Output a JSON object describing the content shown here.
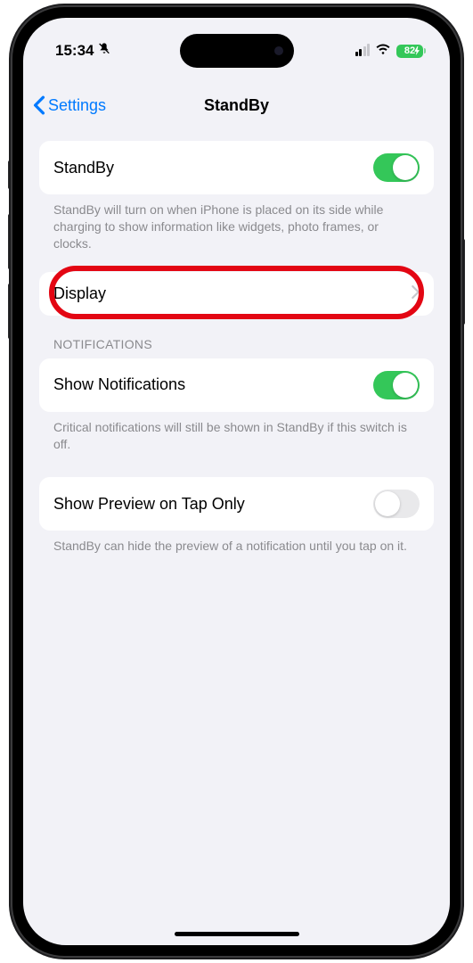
{
  "statusBar": {
    "time": "15:34",
    "batteryText": "82"
  },
  "nav": {
    "backLabel": "Settings",
    "title": "StandBy"
  },
  "rows": {
    "standby": {
      "label": "StandBy",
      "footer": "StandBy will turn on when iPhone is placed on its side while charging to show information like widgets, photo frames, or clocks."
    },
    "display": {
      "label": "Display"
    },
    "notificationsHeader": "Notifications",
    "showNotifications": {
      "label": "Show Notifications",
      "footer": "Critical notifications will still be shown in StandBy if this switch is off."
    },
    "showPreview": {
      "label": "Show Preview on Tap Only",
      "footer": "StandBy can hide the preview of a notification until you tap on it."
    }
  }
}
